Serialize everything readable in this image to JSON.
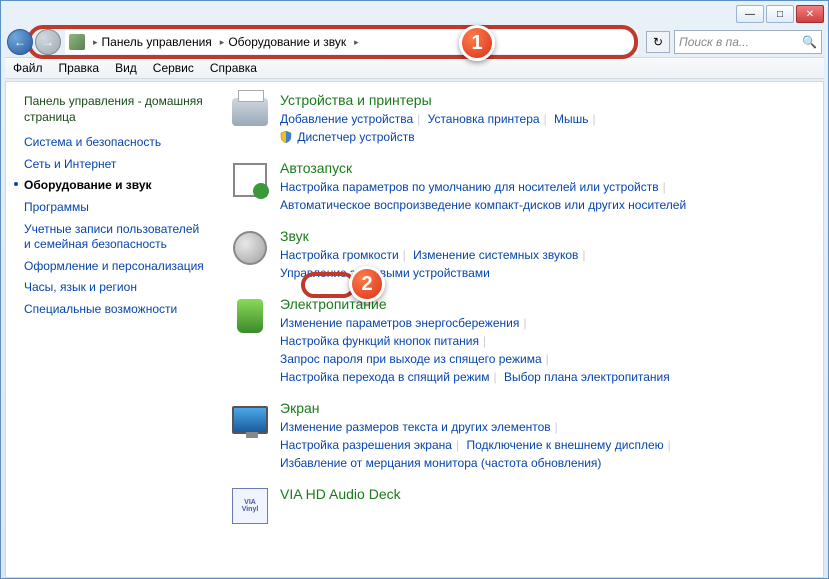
{
  "titlebar": {
    "minimize": "—",
    "maximize": "□",
    "close": "✕"
  },
  "nav": {
    "back": "←",
    "forward": "→",
    "refresh": "↻"
  },
  "breadcrumb": {
    "item1": "Панель управления",
    "item2": "Оборудование и звук"
  },
  "search": {
    "placeholder": "Поиск в па..."
  },
  "menu": {
    "file": "Файл",
    "edit": "Правка",
    "view": "Вид",
    "service": "Сервис",
    "help": "Справка"
  },
  "sidebar": {
    "title": "Панель управления - домашняя страница",
    "items": [
      "Система и безопасность",
      "Сеть и Интернет",
      "Оборудование и звук",
      "Программы",
      "Учетные записи пользователей и семейная безопасность",
      "Оформление и персонализация",
      "Часы, язык и регион",
      "Специальные возможности"
    ]
  },
  "categories": {
    "devices": {
      "title": "Устройства и принтеры",
      "link1": "Добавление устройства",
      "link2": "Установка принтера",
      "link3": "Мышь",
      "link4": "Диспетчер устройств"
    },
    "autoplay": {
      "title": "Автозапуск",
      "link1": "Настройка параметров по умолчанию для носителей или устройств",
      "link2": "Автоматическое воспроизведение компакт-дисков или других носителей"
    },
    "sound": {
      "title": "Звук",
      "link1": "Настройка громкости",
      "link2": "Изменение системных звуков",
      "link3": "Управление звуковыми устройствами"
    },
    "power": {
      "title": "Электропитание",
      "link1": "Изменение параметров энергосбережения",
      "link2": "Настройка функций кнопок питания",
      "link3": "Запрос пароля при выходе из спящего режима",
      "link4": "Настройка перехода в спящий режим",
      "link5": "Выбор плана электропитания"
    },
    "screen": {
      "title": "Экран",
      "link1": "Изменение размеров текста и других элементов",
      "link2": "Настройка разрешения экрана",
      "link3": "Подключение к внешнему дисплею",
      "link4": "Избавление от мерцания монитора (частота обновления)"
    },
    "via": {
      "title": "VIA HD Audio Deck",
      "label1": "VIA",
      "label2": "Vinyl"
    }
  },
  "markers": {
    "m1": "1",
    "m2": "2"
  }
}
